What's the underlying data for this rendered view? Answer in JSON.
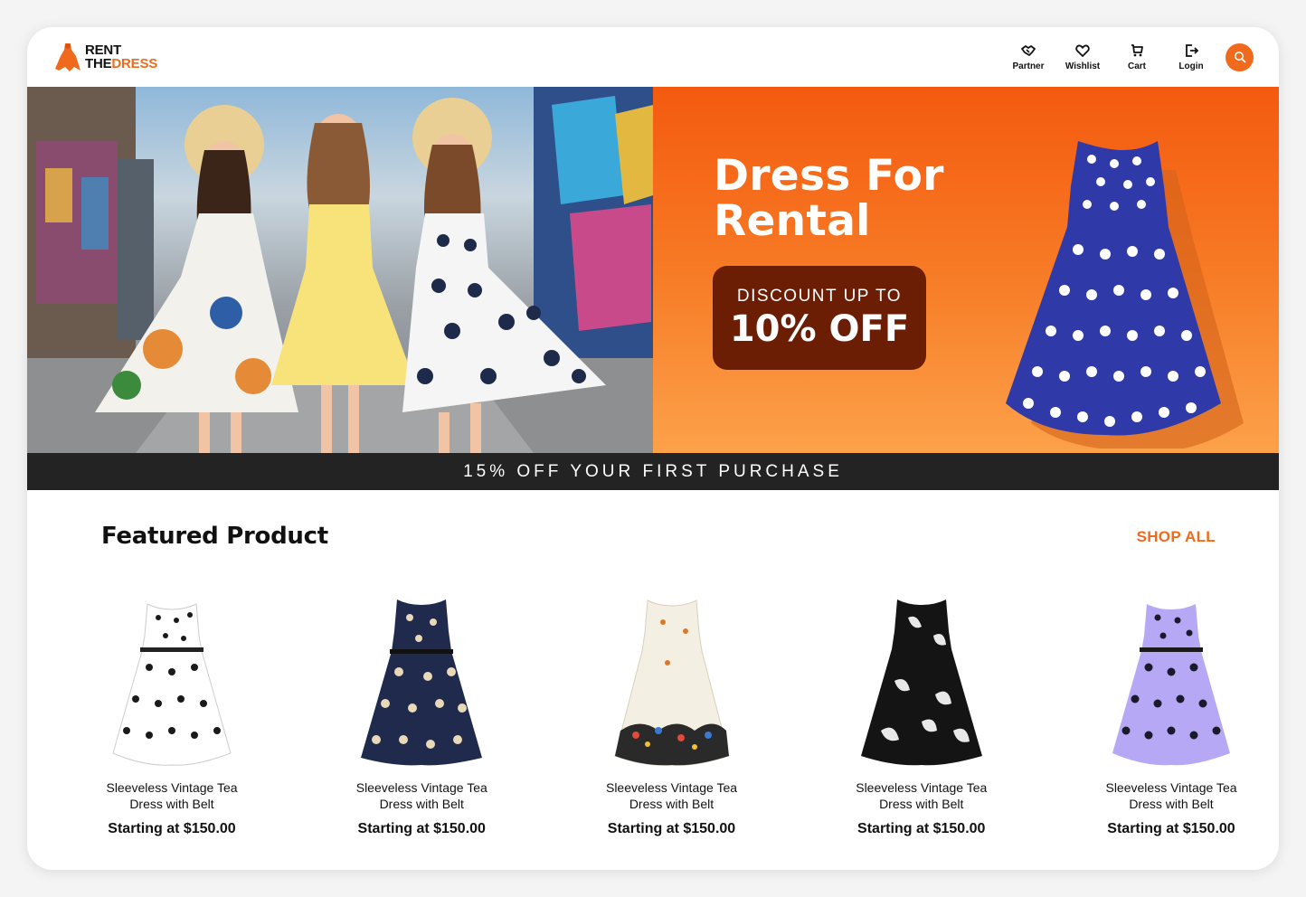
{
  "brand": {
    "line1": "RENT",
    "line2_a": "THE",
    "line2_b": "DRESS",
    "accent": "#f06a1d"
  },
  "nav": [
    {
      "label": "Partner",
      "icon": "handshake-icon"
    },
    {
      "label": "Wishlist",
      "icon": "heart-icon"
    },
    {
      "label": "Cart",
      "icon": "cart-icon"
    },
    {
      "label": "Login",
      "icon": "login-icon"
    }
  ],
  "search": {
    "icon": "search-icon"
  },
  "hero": {
    "title": "Dress For Rental",
    "discount_top": "DISCOUNT UP TO",
    "discount_main": "10% OFF"
  },
  "announcement": "15% OFF YOUR FIRST PURCHASE",
  "featured": {
    "title": "Featured Product",
    "shop_all": "SHOP ALL",
    "products": [
      {
        "name": "Sleeveless Vintage Tea Dress with Belt",
        "price": "Starting at $150.00",
        "color": "#ffffff"
      },
      {
        "name": "Sleeveless Vintage Tea Dress with Belt",
        "price": "Starting at $150.00",
        "color": "#1f2a4d"
      },
      {
        "name": "Sleeveless Vintage Tea Dress with Belt",
        "price": "Starting at $150.00",
        "color": "#f4efe3"
      },
      {
        "name": "Sleeveless Vintage Tea Dress with Belt",
        "price": "Starting at $150.00",
        "color": "#141414"
      },
      {
        "name": "Sleeveless Vintage Tea Dress with Belt",
        "price": "Starting at $150.00",
        "color": "#b7a8f5"
      }
    ]
  }
}
